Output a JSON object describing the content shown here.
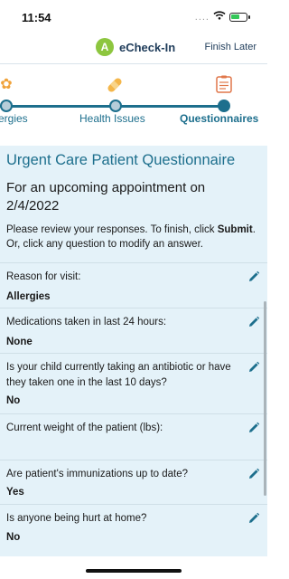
{
  "status": {
    "time": "11:54",
    "signal": "....",
    "wifi": "⌔",
    "battery_level": 0.6
  },
  "header": {
    "logo_letter": "A",
    "title": "eCheck-In",
    "finish_later": "Finish Later"
  },
  "stepper": {
    "steps": [
      {
        "label": "Allergies",
        "visible_label": "ergies",
        "icon": "allergy-icon",
        "glyph": "✿",
        "state": "done"
      },
      {
        "label": "Health Issues",
        "icon": "bandage-icon",
        "glyph": "🩹",
        "state": "done"
      },
      {
        "label": "Questionnaires",
        "icon": "clipboard-icon",
        "glyph": "📋",
        "state": "current"
      }
    ]
  },
  "questionnaire": {
    "title": "Urgent Care Patient Questionnaire",
    "appointment": "For an upcoming appointment on 2/4/2022",
    "instructions_pre": "Please review your responses. To finish, click ",
    "instructions_bold": "Submit",
    "instructions_post": ". Or, click any question to modify an answer.",
    "items": [
      {
        "question": "Reason for visit:",
        "answer": "Allergies"
      },
      {
        "question": "Medications taken in last 24 hours:",
        "answer": "None"
      },
      {
        "question": "Is your child currently taking an antibiotic or have they taken one in the last 10 days?",
        "answer": "No"
      },
      {
        "question": "Current weight of the patient (lbs):",
        "answer": ""
      },
      {
        "question": "Are patient's immunizations up to date?",
        "answer": "Yes"
      },
      {
        "question": "Is anyone being hurt at home?",
        "answer": "No"
      }
    ]
  },
  "colors": {
    "accent": "#1d6f8d",
    "content_bg": "#e4f2f9",
    "logo": "#8dc63f"
  }
}
